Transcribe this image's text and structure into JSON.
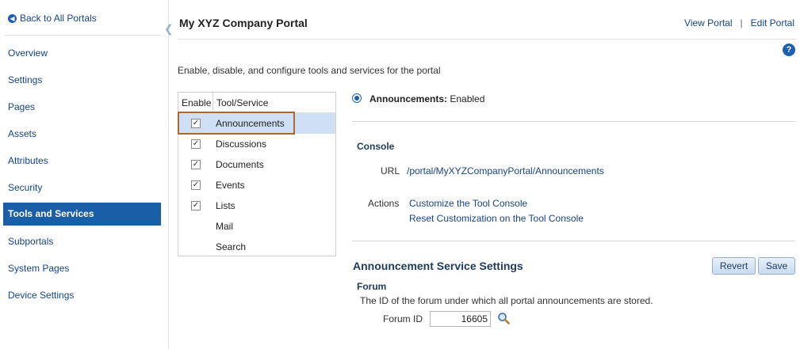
{
  "sidebar": {
    "back_label": "Back to All Portals",
    "items": [
      {
        "label": "Overview"
      },
      {
        "label": "Settings"
      },
      {
        "label": "Pages"
      },
      {
        "label": "Assets"
      },
      {
        "label": "Attributes"
      },
      {
        "label": "Security"
      },
      {
        "label": "Tools and Services",
        "active": true
      },
      {
        "label": "Subportals"
      },
      {
        "label": "System Pages"
      },
      {
        "label": "Device Settings"
      }
    ]
  },
  "header": {
    "title": "My XYZ Company Portal",
    "view_portal": "View Portal",
    "separator": "|",
    "edit_portal": "Edit Portal",
    "help": "?"
  },
  "intro": "Enable, disable, and configure tools and services for the portal",
  "tools_table": {
    "col_enable": "Enable",
    "col_tool": "Tool/Service",
    "rows": [
      {
        "name": "Announcements",
        "enabled": true,
        "selected": true
      },
      {
        "name": "Discussions",
        "enabled": true
      },
      {
        "name": "Documents",
        "enabled": true
      },
      {
        "name": "Events",
        "enabled": true
      },
      {
        "name": "Lists",
        "enabled": true
      },
      {
        "name": "Mail",
        "enabled": null
      },
      {
        "name": "Search",
        "enabled": null
      }
    ]
  },
  "detail": {
    "service_name": "Announcements:",
    "service_status": "Enabled",
    "console_heading": "Console",
    "url_label": "URL",
    "url_value": "/portal/MyXYZCompanyPortal/Announcements",
    "actions_label": "Actions",
    "action_customize": "Customize the Tool Console",
    "action_reset": "Reset Customization on the Tool Console"
  },
  "settings": {
    "heading": "Announcement Service Settings",
    "revert_label": "Revert",
    "save_label": "Save",
    "forum_heading": "Forum",
    "forum_desc": "The ID of the forum under which all portal announcements are stored.",
    "forum_id_label": "Forum ID",
    "forum_id_value": "16605"
  },
  "colors": {
    "accent": "#1a5ea8",
    "link": "#14448a",
    "selected_row": "#cfe0f4",
    "focus_outline": "#a86a2e"
  },
  "icons": {
    "back": "back-arrow-icon",
    "help": "help-icon",
    "collapse": "collapse-arrow-icon",
    "search": "magnifier-icon"
  }
}
